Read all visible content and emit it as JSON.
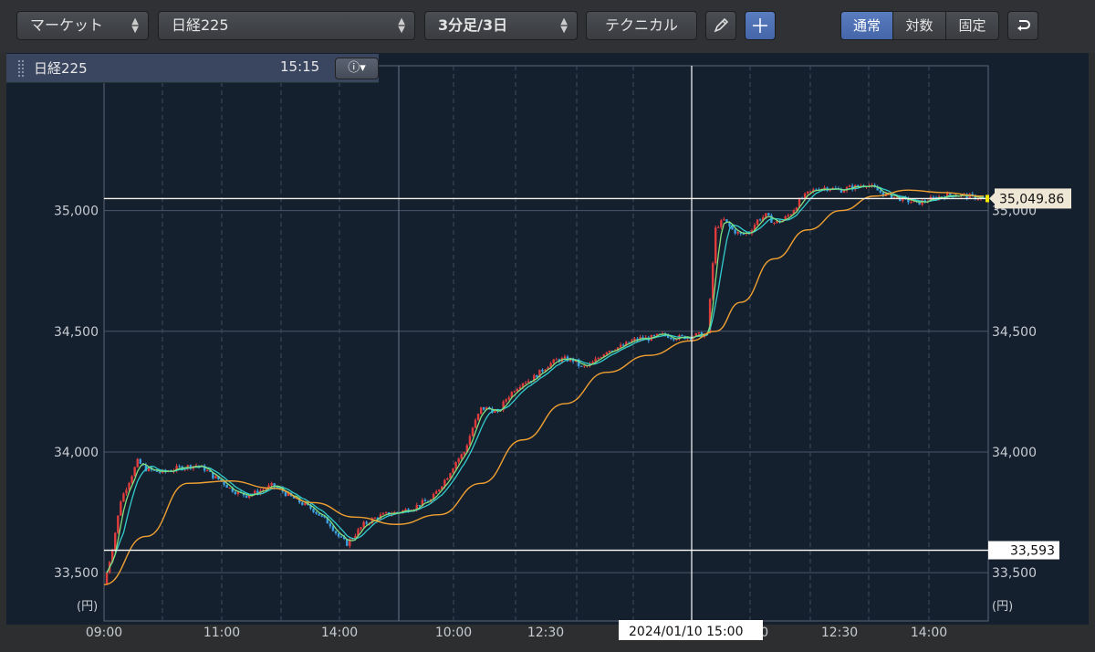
{
  "toolbar": {
    "market_label": "マーケット",
    "symbol_label": "日経225",
    "interval_label": "3分足/3日",
    "technical_label": "テクニカル",
    "pencil_icon": "pencil-icon",
    "crosshair_icon": "crosshair-icon",
    "scale_modes": [
      "通常",
      "対数",
      "固定"
    ],
    "active_scale_mode": "通常",
    "undo_icon": "undo-icon"
  },
  "infobar": {
    "symbol": "日経225",
    "time": "15:15",
    "info_icon": "info-icon"
  },
  "chart_data": {
    "type": "candlestick",
    "yunit": "(円)",
    "ylim": [
      33300,
      35600
    ],
    "yticks": [
      33500,
      34000,
      34500,
      35000
    ],
    "ytick_labels": [
      "33,500",
      "34,000",
      "34,500",
      "35,000"
    ],
    "xtick_labels": [
      "09:00",
      "11:00",
      "14:00",
      "10:00",
      "12:30",
      "15:00",
      "10:00",
      "12:30",
      "14:00"
    ],
    "current_price_label": "35,049.86",
    "current_price": 35049.86,
    "crosshair_price_label": "33,593",
    "crosshair_price": 33593,
    "crosshair_time_label": "2024/01/10 15:00",
    "colors": {
      "background": "#15202f",
      "up": "#e03c3c",
      "down": "#3c9fe0",
      "ma_short": "#7ee07e",
      "ma_long": "#f0a030",
      "ma_mid": "#33cccc"
    },
    "price_path": [
      [
        0,
        33450
      ],
      [
        1,
        33600
      ],
      [
        2,
        33800
      ],
      [
        3,
        33880
      ],
      [
        4,
        33960
      ],
      [
        5,
        33930
      ],
      [
        6,
        33920
      ],
      [
        7,
        33915
      ],
      [
        8,
        33925
      ],
      [
        9,
        33935
      ],
      [
        10,
        33940
      ],
      [
        11,
        33945
      ],
      [
        12,
        33930
      ],
      [
        13,
        33900
      ],
      [
        14,
        33880
      ],
      [
        15,
        33850
      ],
      [
        16,
        33830
      ],
      [
        17,
        33820
      ],
      [
        18,
        33830
      ],
      [
        19,
        33845
      ],
      [
        20,
        33860
      ],
      [
        21,
        33845
      ],
      [
        22,
        33820
      ],
      [
        23,
        33800
      ],
      [
        24,
        33780
      ],
      [
        25,
        33760
      ],
      [
        26,
        33730
      ],
      [
        27,
        33700
      ],
      [
        28,
        33650
      ],
      [
        29,
        33620
      ],
      [
        30,
        33660
      ],
      [
        31,
        33700
      ],
      [
        32,
        33720
      ],
      [
        33,
        33735
      ],
      [
        34,
        33745
      ],
      [
        35,
        33750
      ],
      [
        36,
        33760
      ],
      [
        37,
        33770
      ],
      [
        38,
        33790
      ],
      [
        39,
        33800
      ],
      [
        40,
        33850
      ],
      [
        41,
        33900
      ],
      [
        42,
        33960
      ],
      [
        43,
        34000
      ],
      [
        44,
        34100
      ],
      [
        45,
        34180
      ],
      [
        46,
        34180
      ],
      [
        47,
        34160
      ],
      [
        48,
        34220
      ],
      [
        49,
        34260
      ],
      [
        50,
        34290
      ],
      [
        51,
        34300
      ],
      [
        52,
        34330
      ],
      [
        53,
        34360
      ],
      [
        54,
        34380
      ],
      [
        55,
        34385
      ],
      [
        56,
        34380
      ],
      [
        57,
        34350
      ],
      [
        58,
        34360
      ],
      [
        59,
        34390
      ],
      [
        60,
        34420
      ],
      [
        61,
        34430
      ],
      [
        62,
        34440
      ],
      [
        63,
        34460
      ],
      [
        64,
        34470
      ],
      [
        65,
        34470
      ],
      [
        66,
        34480
      ],
      [
        67,
        34485
      ],
      [
        68,
        34475
      ],
      [
        69,
        34475
      ],
      [
        70,
        34480
      ],
      [
        71,
        34485
      ],
      [
        72,
        34485
      ],
      [
        73,
        34930
      ],
      [
        74,
        34960
      ],
      [
        75,
        34920
      ],
      [
        76,
        34900
      ],
      [
        77,
        34910
      ],
      [
        78,
        34960
      ],
      [
        79,
        34980
      ],
      [
        80,
        34950
      ],
      [
        81,
        34960
      ],
      [
        82,
        34990
      ],
      [
        83,
        35040
      ],
      [
        84,
        35070
      ],
      [
        85,
        35090
      ],
      [
        86,
        35095
      ],
      [
        87,
        35090
      ],
      [
        88,
        35085
      ],
      [
        89,
        35095
      ],
      [
        90,
        35100
      ],
      [
        91,
        35110
      ],
      [
        92,
        35090
      ],
      [
        93,
        35070
      ],
      [
        94,
        35060
      ],
      [
        95,
        35050
      ],
      [
        96,
        35040
      ],
      [
        97,
        35030
      ],
      [
        98,
        35040
      ],
      [
        99,
        35050
      ],
      [
        100,
        35060
      ],
      [
        101,
        35065
      ],
      [
        102,
        35065
      ],
      [
        103,
        35060
      ],
      [
        104,
        35055
      ],
      [
        105,
        35050
      ]
    ],
    "ma_long": [
      [
        0,
        33450
      ],
      [
        5,
        33650
      ],
      [
        10,
        33870
      ],
      [
        15,
        33880
      ],
      [
        20,
        33850
      ],
      [
        25,
        33790
      ],
      [
        30,
        33730
      ],
      [
        35,
        33700
      ],
      [
        40,
        33740
      ],
      [
        45,
        33870
      ],
      [
        50,
        34050
      ],
      [
        55,
        34200
      ],
      [
        60,
        34330
      ],
      [
        65,
        34400
      ],
      [
        70,
        34460
      ],
      [
        73,
        34500
      ],
      [
        76,
        34620
      ],
      [
        80,
        34800
      ],
      [
        84,
        34920
      ],
      [
        88,
        35000
      ],
      [
        92,
        35060
      ],
      [
        96,
        35085
      ],
      [
        100,
        35075
      ],
      [
        105,
        35060
      ]
    ]
  }
}
